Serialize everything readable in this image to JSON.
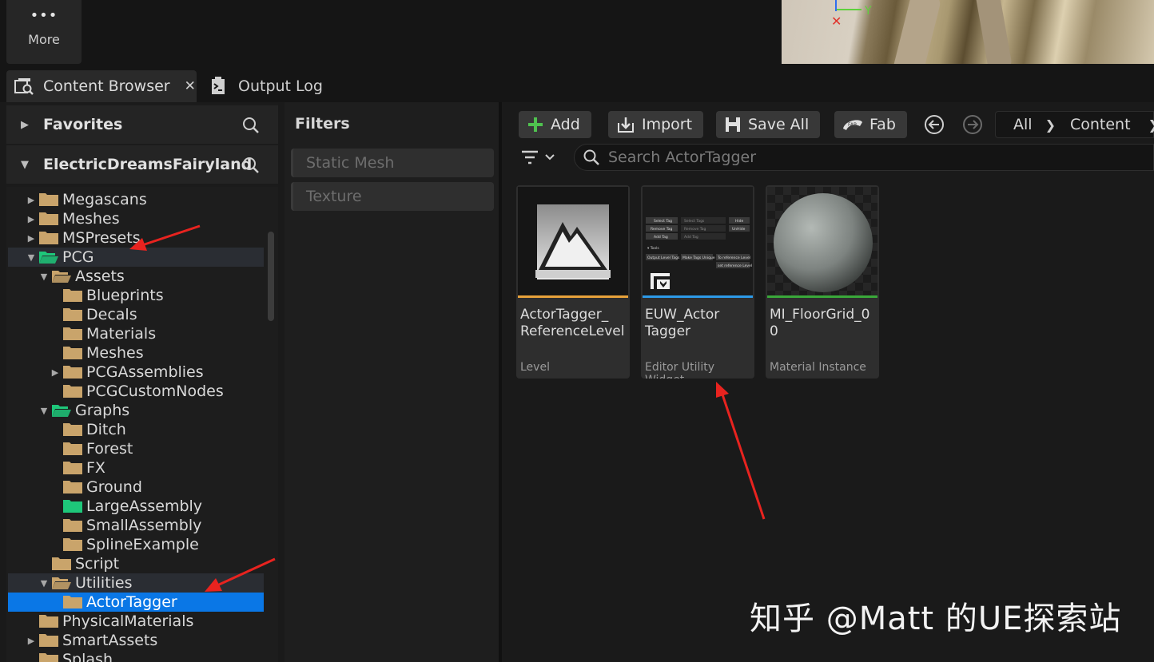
{
  "toolbar": {
    "more_label": "More"
  },
  "tabs": [
    {
      "label": "Content Browser",
      "active": true
    },
    {
      "label": "Output Log",
      "active": false
    }
  ],
  "sources": {
    "favorites_label": "Favorites",
    "project_label": "ElectricDreamsFairyland"
  },
  "tree": [
    {
      "label": "Megascans",
      "depth": 0,
      "arrow": "right"
    },
    {
      "label": "Meshes",
      "depth": 0,
      "arrow": "right"
    },
    {
      "label": "MSPresets",
      "depth": 0,
      "arrow": "right"
    },
    {
      "label": "PCG",
      "depth": 0,
      "arrow": "down",
      "open": true,
      "green": true
    },
    {
      "label": "Assets",
      "depth": 1,
      "arrow": "down",
      "open": true
    },
    {
      "label": "Blueprints",
      "depth": 2
    },
    {
      "label": "Decals",
      "depth": 2
    },
    {
      "label": "Materials",
      "depth": 2
    },
    {
      "label": "Meshes",
      "depth": 2
    },
    {
      "label": "PCGAssemblies",
      "depth": 2,
      "arrow": "right"
    },
    {
      "label": "PCGCustomNodes",
      "depth": 2
    },
    {
      "label": "Graphs",
      "depth": 1,
      "arrow": "down",
      "open": true,
      "green": true
    },
    {
      "label": "Ditch",
      "depth": 2
    },
    {
      "label": "Forest",
      "depth": 2
    },
    {
      "label": "FX",
      "depth": 2
    },
    {
      "label": "Ground",
      "depth": 2
    },
    {
      "label": "LargeAssembly",
      "depth": 2,
      "green": true
    },
    {
      "label": "SmallAssembly",
      "depth": 2
    },
    {
      "label": "SplineExample",
      "depth": 2
    },
    {
      "label": "Script",
      "depth": 1
    },
    {
      "label": "Utilities",
      "depth": 1,
      "arrow": "down",
      "open": true
    },
    {
      "label": "ActorTagger",
      "depth": 2,
      "selected": true
    },
    {
      "label": "PhysicalMaterials",
      "depth": 0
    },
    {
      "label": "SmartAssets",
      "depth": 0,
      "arrow": "right"
    },
    {
      "label": "Splash",
      "depth": 0
    }
  ],
  "filters": {
    "title": "Filters",
    "chips": [
      "Static Mesh",
      "Texture"
    ]
  },
  "content_toolbar": {
    "add_label": "Add",
    "import_label": "Import",
    "save_all_label": "Save All",
    "fab_label": "Fab",
    "breadcrumb": [
      "All",
      "Content"
    ],
    "search_placeholder": "Search ActorTagger"
  },
  "assets": [
    {
      "name": "ActorTagger_\nReferenceLevel",
      "type": "Level",
      "stripe": "#e8a23a"
    },
    {
      "name": "EUW_Actor\nTagger",
      "type": "Editor Utility Widget",
      "stripe": "#2d9ae8"
    },
    {
      "name": "MI_FloorGrid_00",
      "type": "Material Instance",
      "stripe": "#3aa83a"
    }
  ],
  "euw_preview": {
    "select_tag": "Select Tag",
    "select_tags": "Select Tags",
    "hide": "Hide",
    "remove_tag": "Remove Tag",
    "remove_tag_field": "Remove Tag",
    "unhide": "UnHide",
    "add_tag": "Add Tag",
    "add_tag_field": "Add Tag",
    "tools": "▾ Tools",
    "output_level_tags": "Output Level Tags",
    "make_tags_unique": "Make Tags Unique",
    "ref_level": "To reference Level",
    "set_ref_level": "set reference Level"
  },
  "watermark": "知乎 @Matt 的UE探索站",
  "colors": {
    "selection": "#0a77e6",
    "folder": "#c9a46b",
    "folder_green": "#1ec77a",
    "annotation": "#e8231f"
  }
}
